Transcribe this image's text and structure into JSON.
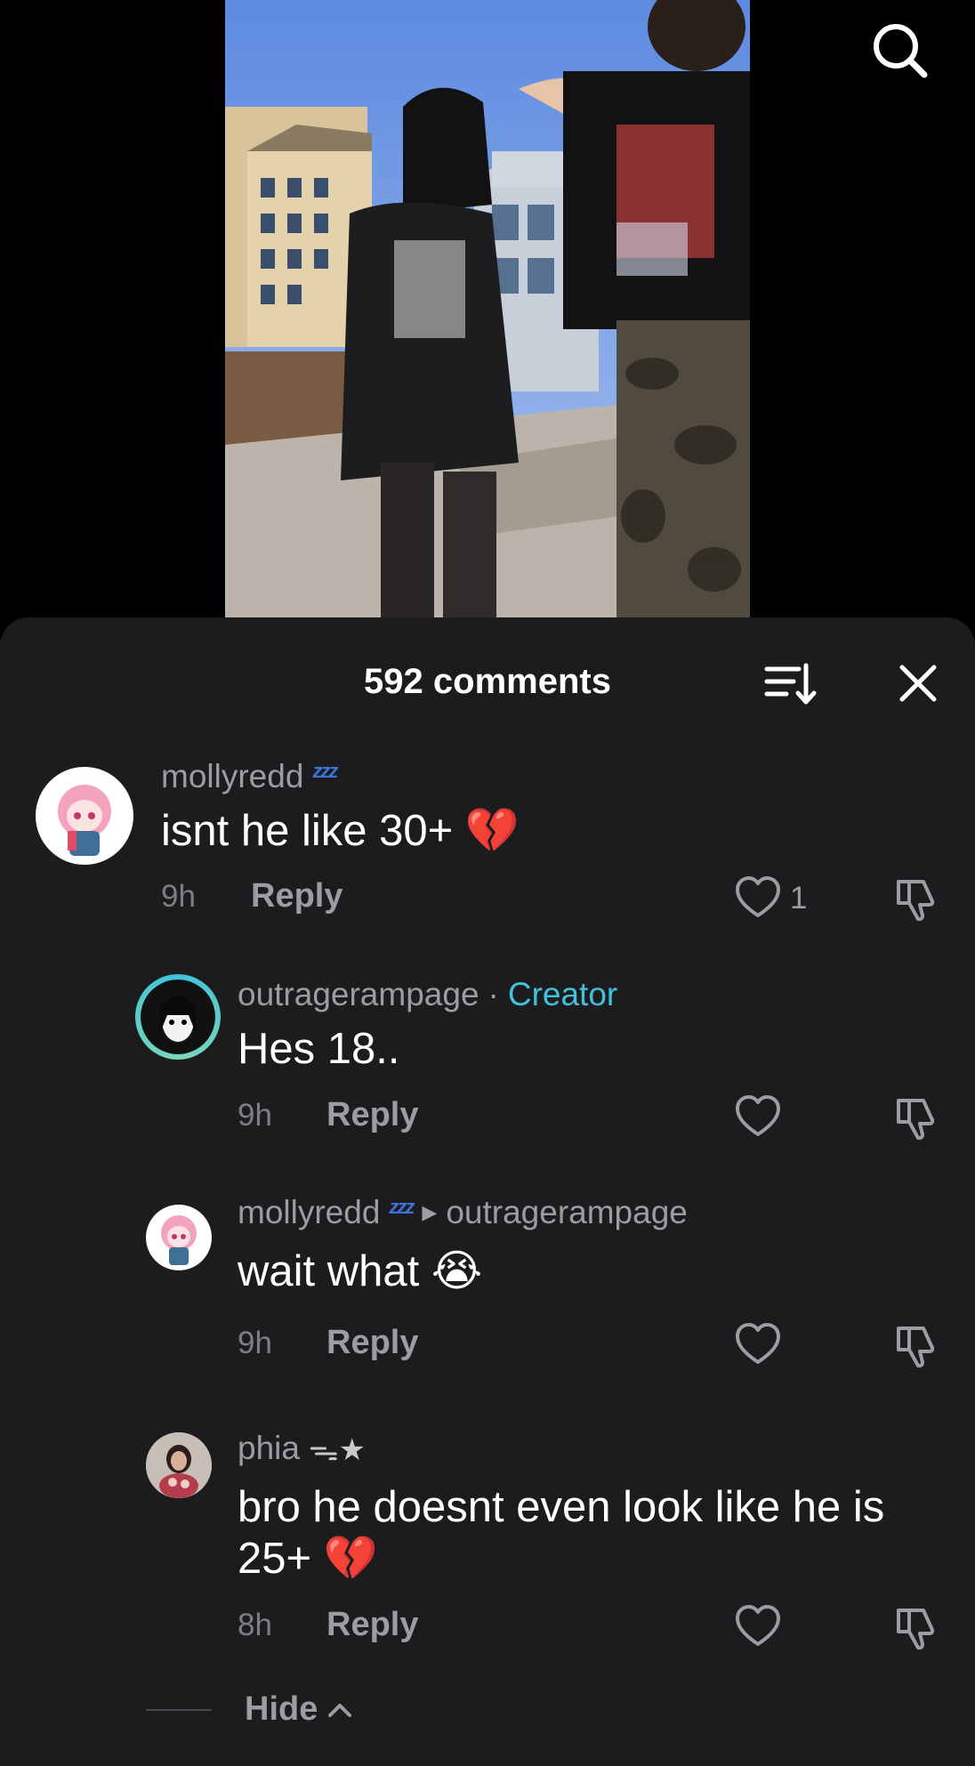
{
  "sheet": {
    "title": "592 comments"
  },
  "comments": [
    {
      "username": "mollyredd",
      "badge": "zzz",
      "text": "isnt he like 30+ 💔",
      "time": "9h",
      "reply_label": "Reply",
      "likes": "1"
    },
    {
      "username": "outragerampage",
      "separator": "·",
      "creator_label": "Creator",
      "text": "Hes 18..",
      "time": "9h",
      "reply_label": "Reply"
    },
    {
      "username": "mollyredd",
      "badge": "zzz",
      "reply_to": "outragerampage",
      "text": "wait what 😭",
      "time": "9h",
      "reply_label": "Reply"
    },
    {
      "username": "phia",
      "badge": "ᯓ★",
      "text": "bro he doesnt even look like he is 25+ 💔",
      "time": "8h",
      "reply_label": "Reply"
    }
  ],
  "footer": {
    "hide_label": "Hide"
  },
  "icons": {
    "search": "search-icon",
    "sort": "sort-icon",
    "close": "close-icon",
    "like": "heart-icon",
    "dislike": "thumbs-down-icon"
  },
  "colors": {
    "sheet_bg": "#1c1c1e",
    "creator": "#3fc2da",
    "muted": "#9c9ca1"
  }
}
